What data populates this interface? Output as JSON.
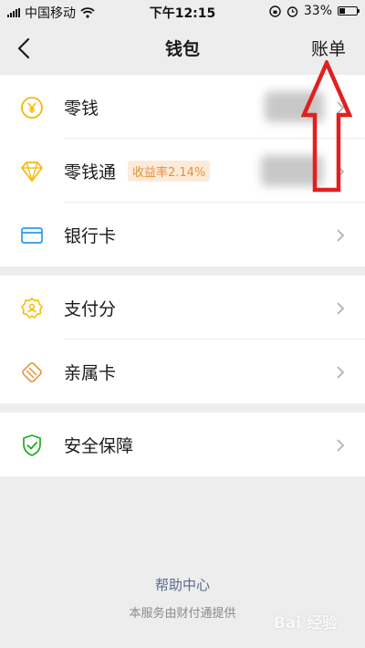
{
  "status_bar": {
    "carrier": "中国移动",
    "time": "下午12:15",
    "battery": "33%",
    "battery_level": 0.33
  },
  "nav": {
    "title": "钱包",
    "action": "账单"
  },
  "rows": [
    {
      "label": "零钱",
      "icon": "yuan-coin-icon"
    },
    {
      "label": "零钱通",
      "badge": "收益率2.14%",
      "icon": "diamond-icon"
    },
    {
      "label": "银行卡",
      "icon": "bank-card-icon"
    },
    {
      "label": "支付分",
      "icon": "pay-score-icon"
    },
    {
      "label": "亲属卡",
      "icon": "family-card-icon"
    },
    {
      "label": "安全保障",
      "icon": "shield-check-icon"
    }
  ],
  "footer": {
    "help": "帮助中心",
    "note": "本服务由财付通提供"
  },
  "watermark": "Bai 经验",
  "colors": {
    "gold": "#f5b800",
    "blue": "#2a9cec",
    "orange": "#e6913a",
    "green": "#1aad19",
    "link": "#576b95",
    "annotation": "#e02020"
  }
}
